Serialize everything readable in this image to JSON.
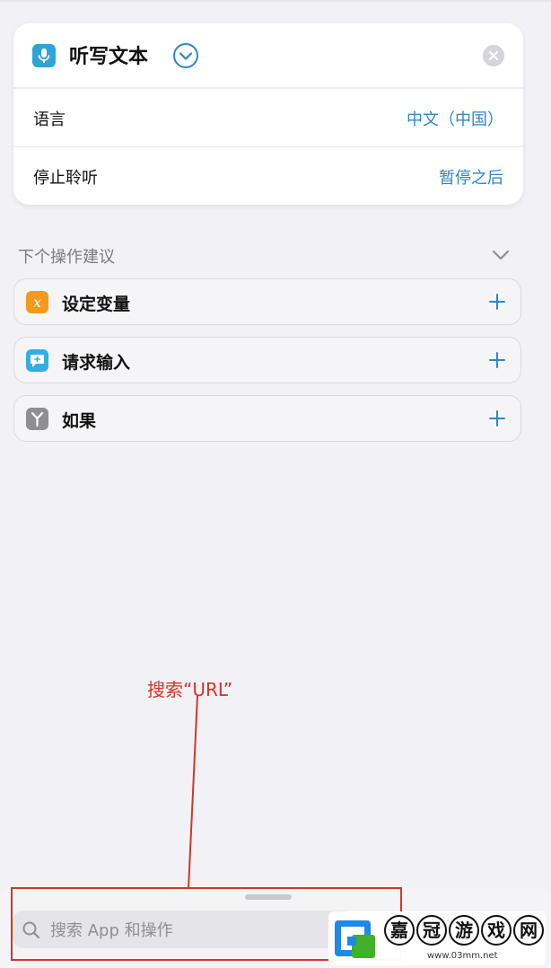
{
  "action_card": {
    "icon": "microphone-icon",
    "title": "听写文本",
    "rows": [
      {
        "label": "语言",
        "value": "中文（中国）"
      },
      {
        "label": "停止聆听",
        "value": "暂停之后"
      }
    ]
  },
  "suggestions": {
    "title": "下个操作建议",
    "items": [
      {
        "label": "设定变量",
        "icon": "variable-icon",
        "color": "#f39a1e"
      },
      {
        "label": "请求输入",
        "icon": "speech-bubble-icon",
        "color": "#32aee2"
      },
      {
        "label": "如果",
        "icon": "branch-icon",
        "color": "#8e8e93"
      }
    ]
  },
  "annotation": {
    "text": "搜索“URL”",
    "color": "#d3352b"
  },
  "search": {
    "placeholder": "搜索 App 和操作"
  },
  "watermark": {
    "chars": [
      "嘉",
      "冠",
      "游",
      "戏",
      "网"
    ],
    "url": "www.03mm.net"
  },
  "colors": {
    "accent": "#2e86c9",
    "background": "#f2f2f6"
  }
}
